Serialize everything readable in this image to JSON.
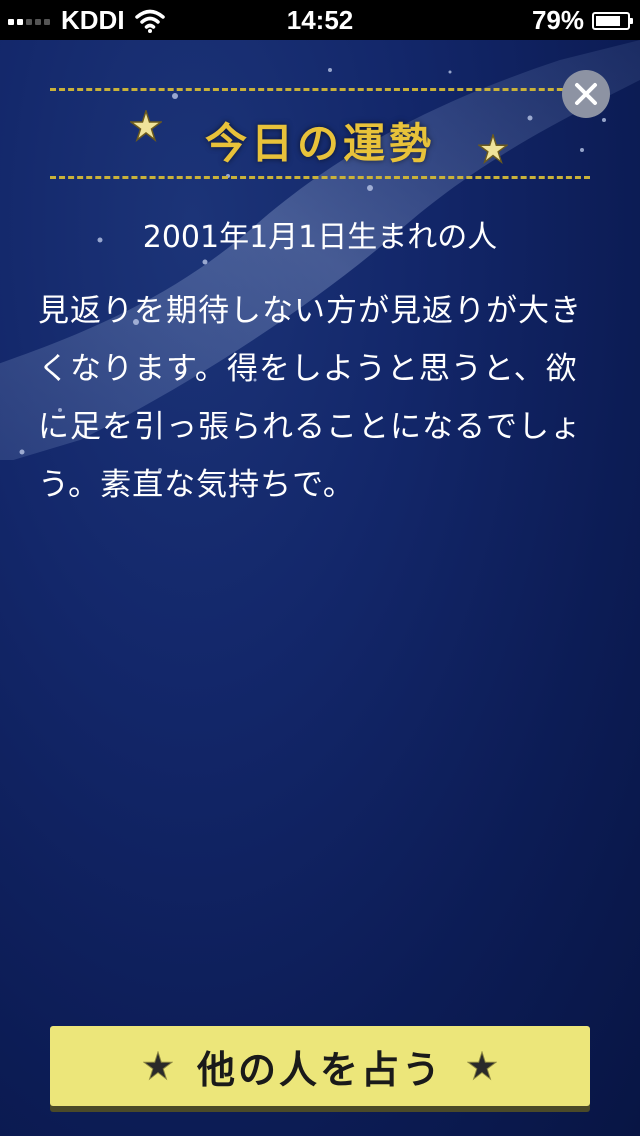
{
  "status_bar": {
    "carrier": "KDDI",
    "time": "14:52",
    "battery_percent": "79%",
    "battery_level": 0.79
  },
  "header": {
    "title": "今日の運勢"
  },
  "content": {
    "birthday_label": "2001年1月1日生まれの人",
    "fortune_text": "見返りを期待しない方が見返りが大きくなります。得をしようと思うと、欲に足を引っ張られることになるでしょう。素直な気持ちで。"
  },
  "footer": {
    "action_label": "他の人を占う"
  },
  "icons": {
    "close": "close-icon",
    "star": "star-icon"
  },
  "colors": {
    "background": "#13276a",
    "title_gold": "#e8c23a",
    "button_yellow": "#ece67a",
    "close_gray": "#8d93a3"
  }
}
